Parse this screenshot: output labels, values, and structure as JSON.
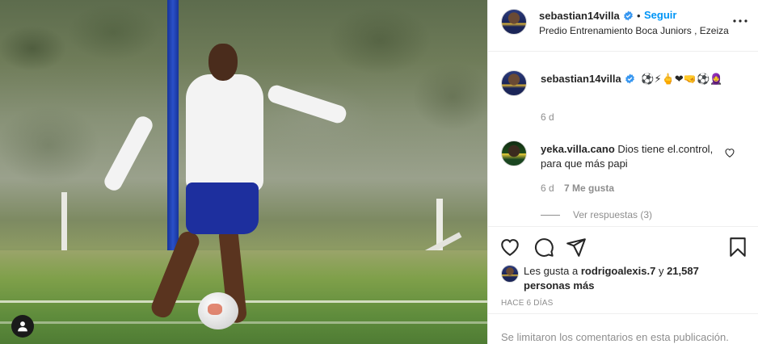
{
  "post": {
    "photo_description_icon": "person-tag-icon"
  },
  "header": {
    "username": "sebastian14villa",
    "separator": "•",
    "follow_label": "Seguir",
    "location": "Predio Entrenamiento Boca Juniors , Ezeiza",
    "more_icon": "more-options-icon"
  },
  "caption": {
    "username": "sebastian14villa",
    "text": "⚽⚡🖕❤🤜⚽🧕",
    "time": "6 d"
  },
  "comments": [
    {
      "username": "yeka.villa.cano",
      "text": "Dios tiene el.control, para que más papi",
      "time": "6 d",
      "likes": "7 Me gusta",
      "replies_label": "Ver respuestas (3)"
    }
  ],
  "actions": {
    "like_icon": "heart-icon",
    "comment_icon": "comment-icon",
    "share_icon": "send-icon",
    "save_icon": "bookmark-icon"
  },
  "likes": {
    "prefix": "Les gusta a",
    "user": "rodrigoalexis.7",
    "connector": "y",
    "others": "21,587 personas más"
  },
  "timestamp": "HACE 6 DÍAS",
  "footer": {
    "comments_disabled": "Se limitaron los comentarios en esta publicación."
  },
  "colors": {
    "accent": "#0095f6",
    "verified": "#3897f0",
    "text": "#262626",
    "muted": "#8e8e8e"
  }
}
